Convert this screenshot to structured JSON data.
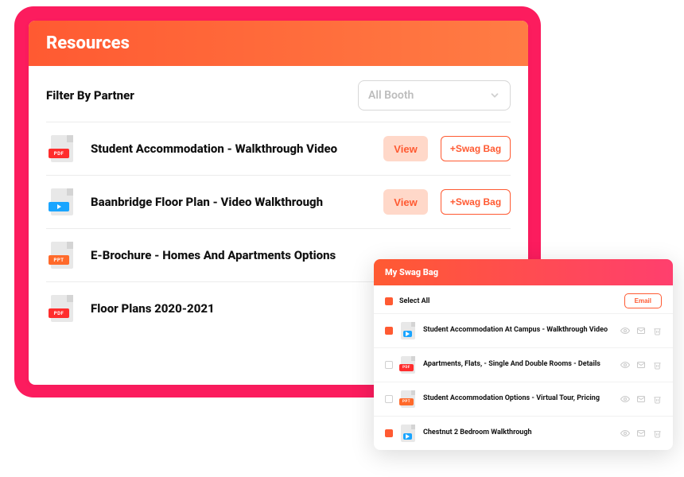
{
  "resources": {
    "header": "Resources",
    "filterLabel": "Filter By Partner",
    "dropdown": {
      "selected": "All Booth"
    },
    "viewLabel": "View",
    "swagLabel": "+Swag Bag",
    "items": [
      {
        "type": "pdf",
        "title": "Student Accommodation - Walkthrough Video",
        "buttons": true
      },
      {
        "type": "vid",
        "title": "Baanbridge Floor Plan - Video Walkthrough",
        "buttons": true
      },
      {
        "type": "ppt",
        "title": "E-Brochure - Homes And Apartments Options",
        "buttons": false
      },
      {
        "type": "pdf",
        "title": "Floor Plans 2020-2021",
        "buttons": false
      }
    ]
  },
  "swag": {
    "header": "My Swag Bag",
    "selectAll": "Select All",
    "emailLabel": "Email",
    "items": [
      {
        "type": "vid",
        "checked": true,
        "title": "Student Accommodation At Campus - Walkthrough Video"
      },
      {
        "type": "pdf",
        "checked": false,
        "title": "Apartments, Flats, - Single And Double Rooms - Details"
      },
      {
        "type": "ppt",
        "checked": false,
        "title": "Student Accommodation Options - Virtual Tour, Pricing"
      },
      {
        "type": "vid",
        "checked": true,
        "title": "Chestnut 2 Bedroom Walkthrough"
      }
    ]
  }
}
